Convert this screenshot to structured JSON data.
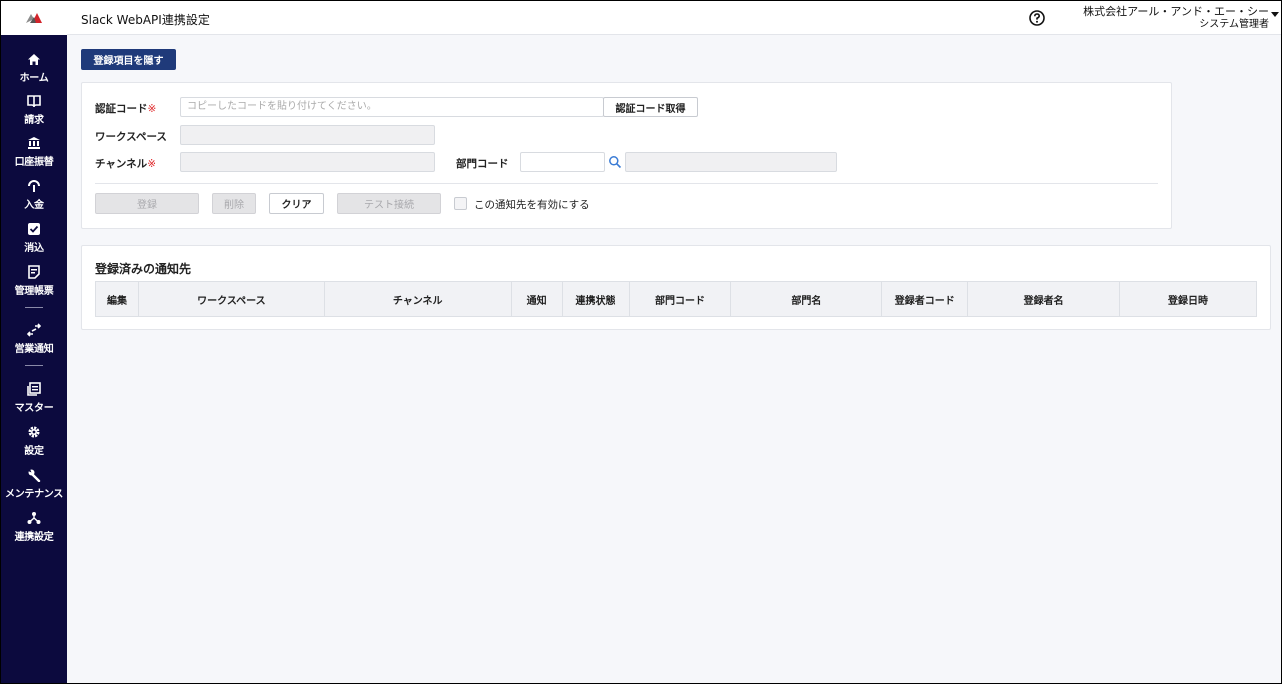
{
  "header": {
    "title": "Slack WebAPI連携設定",
    "company": "株式会社アール・アンド・エー・シー",
    "role": "システム管理者"
  },
  "sidebar": {
    "items": [
      {
        "label": "ホーム",
        "icon": "home-icon"
      },
      {
        "label": "請求",
        "icon": "book-icon"
      },
      {
        "label": "口座振替",
        "icon": "bank-icon"
      },
      {
        "label": "入金",
        "icon": "deposit-icon"
      },
      {
        "label": "消込",
        "icon": "check-icon"
      },
      {
        "label": "管理帳票",
        "icon": "report-icon"
      },
      {
        "label": "営業通知",
        "icon": "transfer-icon"
      },
      {
        "label": "マスター",
        "icon": "master-icon"
      },
      {
        "label": "設定",
        "icon": "gear-icon"
      },
      {
        "label": "メンテナンス",
        "icon": "wrench-icon"
      },
      {
        "label": "連携設定",
        "icon": "share-icon"
      }
    ]
  },
  "toggle_button": "登録項目を隠す",
  "form": {
    "auth_code_label": "認証コード",
    "required_mark": "※",
    "auth_code_placeholder": "コピーしたコードを貼り付けてください。",
    "auth_code_button": "認証コード取得",
    "workspace_label": "ワークスペース",
    "channel_label": "チャンネル",
    "dept_code_label": "部門コード",
    "register_button": "登録",
    "delete_button": "削除",
    "clear_button": "クリア",
    "test_button": "テスト接続",
    "enable_label": "この通知先を有効にする"
  },
  "registered": {
    "title": "登録済みの通知先",
    "columns": [
      "編集",
      "ワークスペース",
      "チャンネル",
      "通知",
      "連携状態",
      "部門コード",
      "部門名",
      "登録者コード",
      "登録者名",
      "登録日時"
    ]
  },
  "colors": {
    "sidebar": "#0c0a3e",
    "primary_button": "#1f3a7a",
    "required": "#e0272a"
  }
}
